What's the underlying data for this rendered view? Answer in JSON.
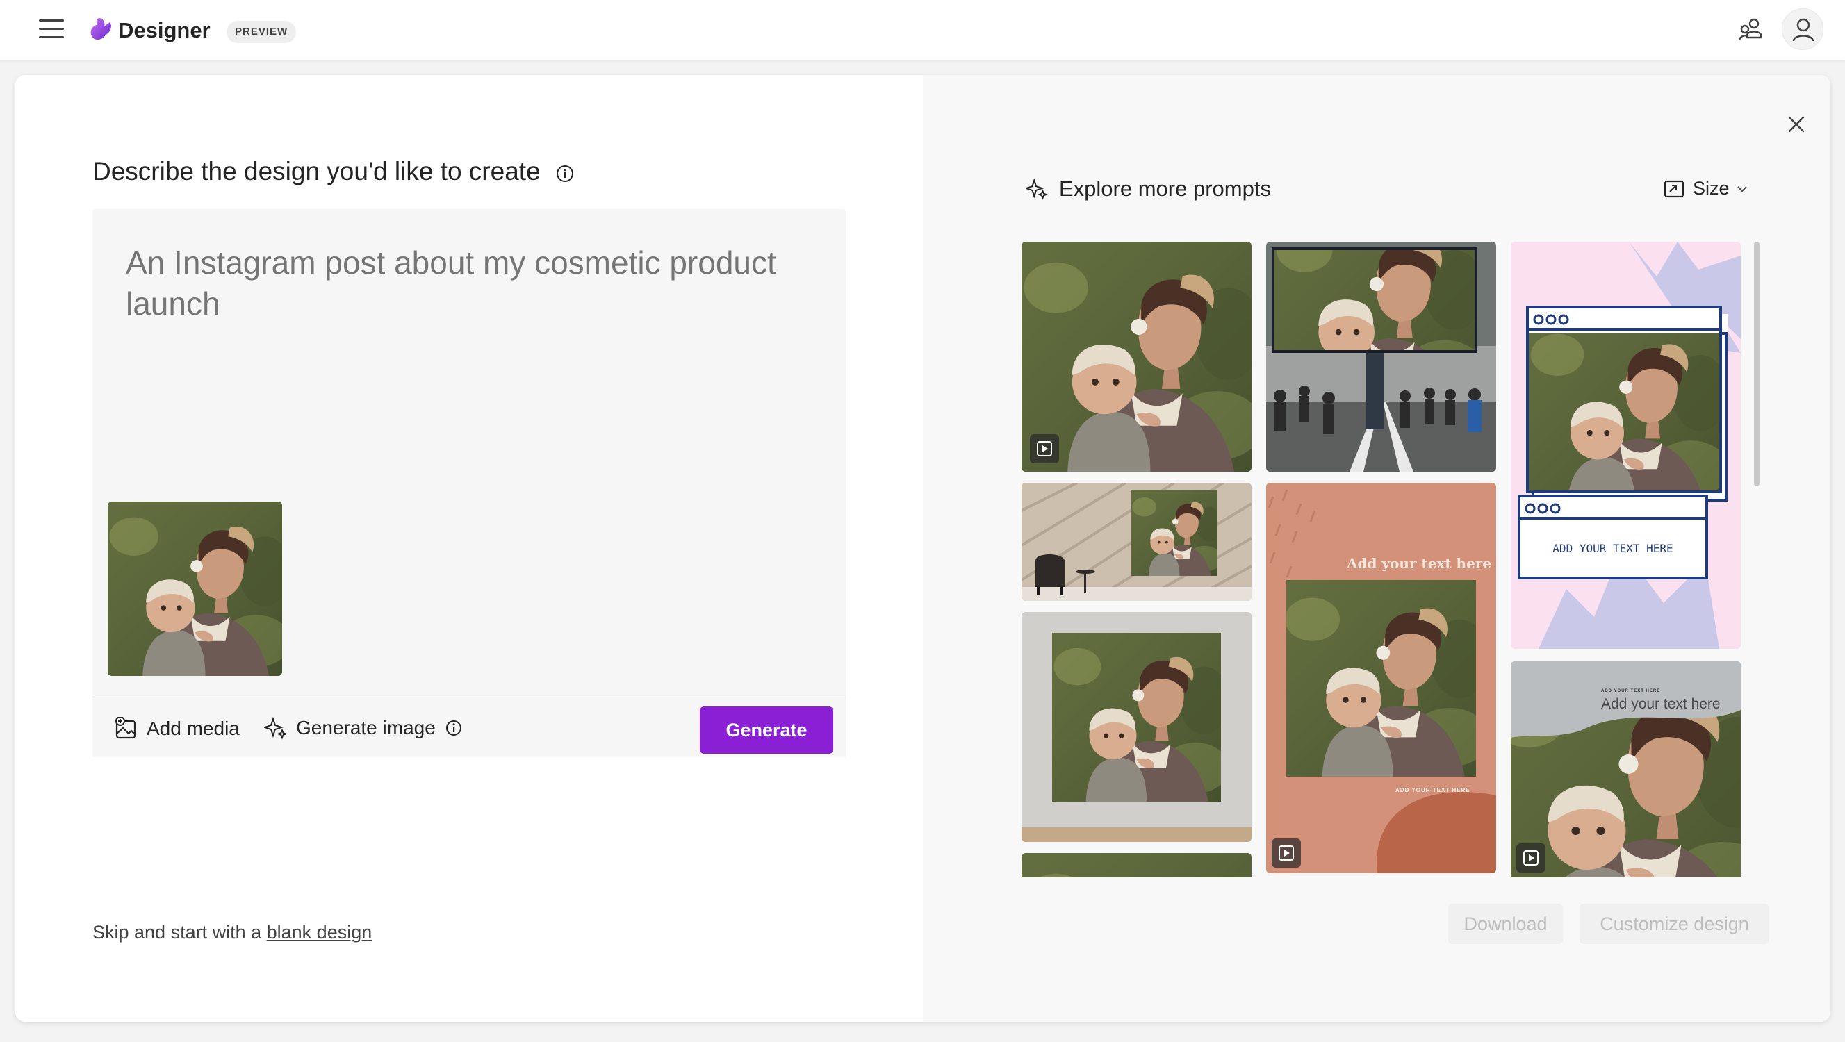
{
  "app": {
    "brand": "Designer",
    "badge": "PREVIEW"
  },
  "header": {
    "menu_icon": "hamburger-menu-icon",
    "share_icon": "people-share-icon",
    "account_icon": "person-icon"
  },
  "left": {
    "heading": "Describe the design you'd like to create",
    "prompt_placeholder": "An Instagram post about my cosmetic product launch",
    "add_media_label": "Add media",
    "generate_image_label": "Generate image",
    "generate_button": "Generate",
    "skip_prefix": "Skip and start with a ",
    "skip_link": "blank design"
  },
  "right": {
    "explore_label": "Explore more prompts",
    "size_label": "Size",
    "download_label": "Download",
    "customize_label": "Customize design",
    "templates": {
      "banner_text": "Add your text here",
      "small_text": "ADD YOUR TEXT HERE",
      "caps_text": "ADD YOUR TEXT HERE",
      "script_text": "Add your text here",
      "tiny_text": "ADD YOUR TEXT HERE"
    }
  },
  "colors": {
    "accent": "#8a1fd6",
    "peach_bg": "#d4917a",
    "pink_bg": "#fbe0ef",
    "lavender": "#c8c8e8",
    "navy": "#1f3b7a",
    "gray_bg": "#b9bdbf"
  }
}
